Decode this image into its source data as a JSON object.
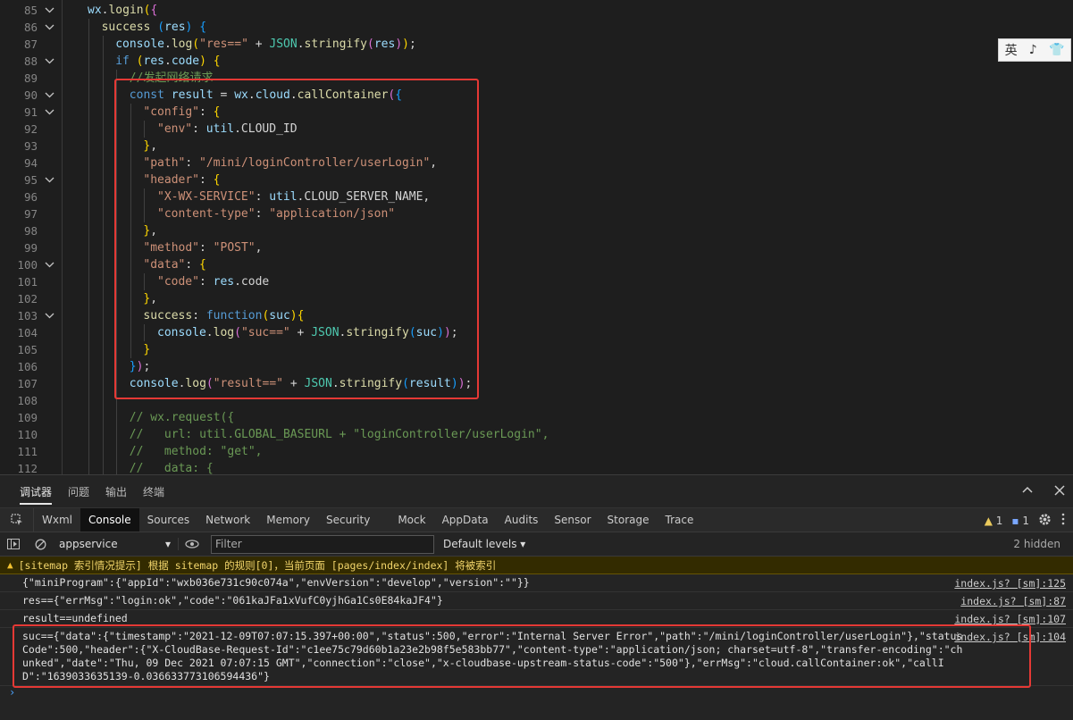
{
  "editor": {
    "lines": [
      {
        "num": "85",
        "fold": true,
        "indent": 0,
        "tokens": [
          [
            "t-var",
            "wx"
          ],
          [
            "t-plain",
            "."
          ],
          [
            "t-fn",
            "login"
          ],
          [
            "t-br",
            "("
          ],
          [
            "t-br2",
            "{"
          ]
        ]
      },
      {
        "num": "86",
        "fold": true,
        "indent": 1,
        "tokens": [
          [
            "t-fn",
            "success"
          ],
          [
            "t-plain",
            " "
          ],
          [
            "t-br3",
            "("
          ],
          [
            "t-var",
            "res"
          ],
          [
            "t-br3",
            ")"
          ],
          [
            "t-plain",
            " "
          ],
          [
            "t-br3",
            "{"
          ]
        ]
      },
      {
        "num": "87",
        "fold": false,
        "indent": 2,
        "tokens": [
          [
            "t-var",
            "console"
          ],
          [
            "t-plain",
            "."
          ],
          [
            "t-fn",
            "log"
          ],
          [
            "t-br",
            "("
          ],
          [
            "t-str",
            "\"res==\""
          ],
          [
            "t-plain",
            " + "
          ],
          [
            "t-obj",
            "JSON"
          ],
          [
            "t-plain",
            "."
          ],
          [
            "t-fn",
            "stringify"
          ],
          [
            "t-br2",
            "("
          ],
          [
            "t-var",
            "res"
          ],
          [
            "t-br2",
            ")"
          ],
          [
            "t-br",
            ")"
          ],
          [
            "t-plain",
            ";"
          ]
        ]
      },
      {
        "num": "88",
        "fold": true,
        "indent": 2,
        "tokens": [
          [
            "t-kw",
            "if"
          ],
          [
            "t-plain",
            " "
          ],
          [
            "t-br",
            "("
          ],
          [
            "t-var",
            "res"
          ],
          [
            "t-plain",
            "."
          ],
          [
            "t-var",
            "code"
          ],
          [
            "t-br",
            ")"
          ],
          [
            "t-plain",
            " "
          ],
          [
            "t-br",
            "{"
          ]
        ]
      },
      {
        "num": "89",
        "fold": false,
        "indent": 3,
        "tokens": [
          [
            "t-cmt",
            "//发起网络请求"
          ]
        ]
      },
      {
        "num": "90",
        "fold": true,
        "indent": 3,
        "tokens": [
          [
            "t-kw",
            "const"
          ],
          [
            "t-plain",
            " "
          ],
          [
            "t-var",
            "result"
          ],
          [
            "t-plain",
            " = "
          ],
          [
            "t-var",
            "wx"
          ],
          [
            "t-plain",
            "."
          ],
          [
            "t-var",
            "cloud"
          ],
          [
            "t-plain",
            "."
          ],
          [
            "t-fn",
            "callContainer"
          ],
          [
            "t-br2",
            "("
          ],
          [
            "t-br3",
            "{"
          ]
        ]
      },
      {
        "num": "91",
        "fold": true,
        "indent": 4,
        "tokens": [
          [
            "t-str",
            "\"config\""
          ],
          [
            "t-plain",
            ": "
          ],
          [
            "t-br",
            "{"
          ]
        ]
      },
      {
        "num": "92",
        "fold": false,
        "indent": 5,
        "tokens": [
          [
            "t-str",
            "\"env\""
          ],
          [
            "t-plain",
            ": "
          ],
          [
            "t-var",
            "util"
          ],
          [
            "t-plain",
            ".CLOUD_ID"
          ]
        ]
      },
      {
        "num": "93",
        "fold": false,
        "indent": 4,
        "tokens": [
          [
            "t-br",
            "}"
          ],
          [
            "t-plain",
            ","
          ]
        ]
      },
      {
        "num": "94",
        "fold": false,
        "indent": 4,
        "tokens": [
          [
            "t-str",
            "\"path\""
          ],
          [
            "t-plain",
            ": "
          ],
          [
            "t-str",
            "\"/mini/loginController/userLogin\""
          ],
          [
            "t-plain",
            ","
          ]
        ]
      },
      {
        "num": "95",
        "fold": true,
        "indent": 4,
        "tokens": [
          [
            "t-str",
            "\"header\""
          ],
          [
            "t-plain",
            ": "
          ],
          [
            "t-br",
            "{"
          ]
        ]
      },
      {
        "num": "96",
        "fold": false,
        "indent": 5,
        "tokens": [
          [
            "t-str",
            "\"X-WX-SERVICE\""
          ],
          [
            "t-plain",
            ": "
          ],
          [
            "t-var",
            "util"
          ],
          [
            "t-plain",
            ".CLOUD_SERVER_NAME,"
          ]
        ]
      },
      {
        "num": "97",
        "fold": false,
        "indent": 5,
        "tokens": [
          [
            "t-str",
            "\"content-type\""
          ],
          [
            "t-plain",
            ": "
          ],
          [
            "t-str",
            "\"application/json\""
          ]
        ]
      },
      {
        "num": "98",
        "fold": false,
        "indent": 4,
        "tokens": [
          [
            "t-br",
            "}"
          ],
          [
            "t-plain",
            ","
          ]
        ]
      },
      {
        "num": "99",
        "fold": false,
        "indent": 4,
        "tokens": [
          [
            "t-str",
            "\"method\""
          ],
          [
            "t-plain",
            ": "
          ],
          [
            "t-str",
            "\"POST\""
          ],
          [
            "t-plain",
            ","
          ]
        ]
      },
      {
        "num": "100",
        "fold": true,
        "indent": 4,
        "tokens": [
          [
            "t-str",
            "\"data\""
          ],
          [
            "t-plain",
            ": "
          ],
          [
            "t-br",
            "{"
          ]
        ]
      },
      {
        "num": "101",
        "fold": false,
        "indent": 5,
        "tokens": [
          [
            "t-str",
            "\"code\""
          ],
          [
            "t-plain",
            ": "
          ],
          [
            "t-var",
            "res"
          ],
          [
            "t-plain",
            ".code"
          ]
        ]
      },
      {
        "num": "102",
        "fold": false,
        "indent": 4,
        "tokens": [
          [
            "t-br",
            "}"
          ],
          [
            "t-plain",
            ","
          ]
        ]
      },
      {
        "num": "103",
        "fold": true,
        "indent": 4,
        "tokens": [
          [
            "t-fn",
            "success"
          ],
          [
            "t-plain",
            ": "
          ],
          [
            "t-kw",
            "function"
          ],
          [
            "t-br",
            "("
          ],
          [
            "t-var",
            "suc"
          ],
          [
            "t-br",
            ")"
          ],
          [
            "t-br",
            "{"
          ]
        ]
      },
      {
        "num": "104",
        "fold": false,
        "indent": 5,
        "tokens": [
          [
            "t-var",
            "console"
          ],
          [
            "t-plain",
            "."
          ],
          [
            "t-fn",
            "log"
          ],
          [
            "t-br2",
            "("
          ],
          [
            "t-str",
            "\"suc==\""
          ],
          [
            "t-plain",
            " + "
          ],
          [
            "t-obj",
            "JSON"
          ],
          [
            "t-plain",
            "."
          ],
          [
            "t-fn",
            "stringify"
          ],
          [
            "t-br3",
            "("
          ],
          [
            "t-var",
            "suc"
          ],
          [
            "t-br3",
            ")"
          ],
          [
            "t-br2",
            ")"
          ],
          [
            "t-plain",
            ";"
          ]
        ]
      },
      {
        "num": "105",
        "fold": false,
        "indent": 4,
        "tokens": [
          [
            "t-br",
            "}"
          ]
        ]
      },
      {
        "num": "106",
        "fold": false,
        "indent": 3,
        "tokens": [
          [
            "t-br3",
            "}"
          ],
          [
            "t-br2",
            ")"
          ],
          [
            "t-plain",
            ";"
          ]
        ]
      },
      {
        "num": "107",
        "fold": false,
        "indent": 3,
        "tokens": [
          [
            "t-var",
            "console"
          ],
          [
            "t-plain",
            "."
          ],
          [
            "t-fn",
            "log"
          ],
          [
            "t-br2",
            "("
          ],
          [
            "t-str",
            "\"result==\""
          ],
          [
            "t-plain",
            " + "
          ],
          [
            "t-obj",
            "JSON"
          ],
          [
            "t-plain",
            "."
          ],
          [
            "t-fn",
            "stringify"
          ],
          [
            "t-br3",
            "("
          ],
          [
            "t-var",
            "result"
          ],
          [
            "t-br3",
            ")"
          ],
          [
            "t-br2",
            ")"
          ],
          [
            "t-plain",
            ";"
          ]
        ]
      },
      {
        "num": "108",
        "fold": false,
        "indent": 3,
        "tokens": []
      },
      {
        "num": "109",
        "fold": false,
        "indent": 3,
        "tokens": [
          [
            "t-cmt",
            "// wx.request({"
          ]
        ]
      },
      {
        "num": "110",
        "fold": false,
        "indent": 3,
        "tokens": [
          [
            "t-cmt",
            "//   url: util.GLOBAL_BASEURL + \"loginController/userLogin\","
          ]
        ]
      },
      {
        "num": "111",
        "fold": false,
        "indent": 3,
        "tokens": [
          [
            "t-cmt",
            "//   method: \"get\","
          ]
        ]
      },
      {
        "num": "112",
        "fold": false,
        "indent": 3,
        "tokens": [
          [
            "t-cmt",
            "//   data: {"
          ]
        ]
      }
    ],
    "ime": {
      "lang": "英",
      "mode": "♪",
      "shirt": "👕"
    }
  },
  "devtools": {
    "panel_tabs": [
      "调试器",
      "问题",
      "输出",
      "终端"
    ],
    "tool_tabs": [
      "Wxml",
      "Console",
      "Sources",
      "Network",
      "Memory",
      "Security",
      "Mock",
      "AppData",
      "Audits",
      "Sensor",
      "Storage",
      "Trace"
    ],
    "active_tool_tab": "Console",
    "warn_count": "1",
    "msg_count": "1",
    "context": "appservice",
    "filter_placeholder": "Filter",
    "levels": "Default levels",
    "hidden": "2 hidden"
  },
  "console": {
    "warning": "[sitemap 索引情况提示] 根据 sitemap 的规则[0]，当前页面 [pages/index/index] 将被索引",
    "rows": [
      {
        "text": "{\"miniProgram\":{\"appId\":\"wxb036e731c90c074a\",\"envVersion\":\"develop\",\"version\":\"\"}}",
        "src": "index.js? [sm]:125"
      },
      {
        "text": "res=={\"errMsg\":\"login:ok\",\"code\":\"061kaJFa1xVufC0yjhGa1Cs0E84kaJF4\"}",
        "src": "index.js? [sm]:87"
      },
      {
        "text": "result==undefined",
        "src": "index.js? [sm]:107"
      },
      {
        "text": "suc=={\"data\":{\"timestamp\":\"2021-12-09T07:07:15.397+00:00\",\"status\":500,\"error\":\"Internal Server Error\",\"path\":\"/mini/loginController/userLogin\"},\"statusCode\":500,\"header\":{\"X-CloudBase-Request-Id\":\"c1ee75c79d60b1a23e2b98f5e583bb77\",\"content-type\":\"application/json; charset=utf-8\",\"transfer-encoding\":\"chunked\",\"date\":\"Thu, 09 Dec 2021 07:07:15 GMT\",\"connection\":\"close\",\"x-cloudbase-upstream-status-code\":\"500\"},\"errMsg\":\"cloud.callContainer:ok\",\"callID\":\"1639033635139-0.036633773106594436\"}",
        "src": "index.js? [sm]:104"
      }
    ],
    "prompt": "›"
  }
}
